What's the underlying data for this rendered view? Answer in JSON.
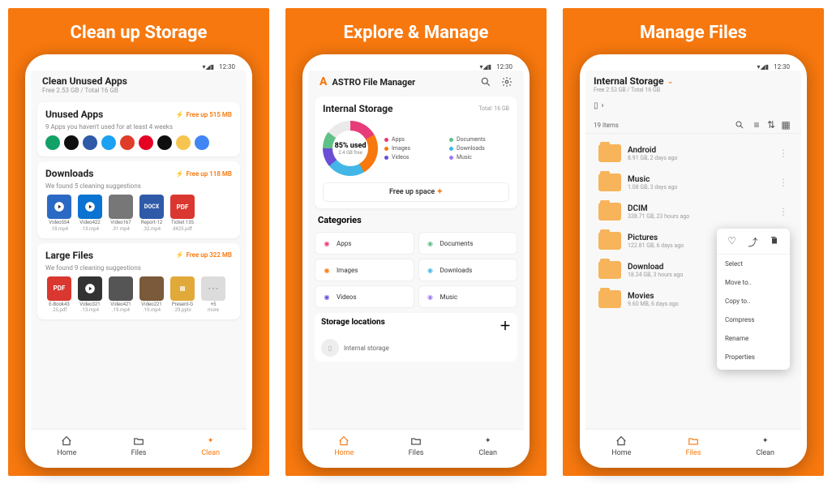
{
  "panels": {
    "p1_title": "Clean up Storage",
    "p2_title": "Explore & Manage",
    "p3_title": "Manage Files"
  },
  "status_bar": {
    "time": "12:30"
  },
  "nav": {
    "home": "Home",
    "files": "Files",
    "clean": "Clean"
  },
  "screen1": {
    "header_title": "Clean Unused Apps",
    "header_sub": "Free 2.53 GB / Total 16 GB",
    "unused": {
      "title": "Unused Apps",
      "freeup": "Free up 515 MB",
      "sub": "9 Apps you haven't used for at least 4 weeks",
      "apps": [
        {
          "bg": "#12a166"
        },
        {
          "bg": "#0f0f0f"
        },
        {
          "bg": "#2e5aa8"
        },
        {
          "bg": "#1da1f2"
        },
        {
          "bg": "#e03c2a"
        },
        {
          "bg": "#e60023"
        },
        {
          "bg": "#0f0f0f"
        },
        {
          "bg": "#f6c550"
        },
        {
          "bg": "#4285f4"
        }
      ]
    },
    "downloads": {
      "title": "Downloads",
      "freeup": "Free up 118 MB",
      "sub": "We found 5 cleaning suggestions",
      "items": [
        {
          "name": "Video554",
          "ext": ".18.mp4",
          "bg": "#2b6ac4",
          "icon": "play"
        },
        {
          "name": "Video422",
          "ext": ".13.mp4",
          "bg": "#0b73d1",
          "icon": "play"
        },
        {
          "name": "Video167",
          "ext": ".31 mp4",
          "bg": "#777",
          "icon": "photo"
        },
        {
          "name": "Report-12",
          "ext": ".32.mp4",
          "bg": "#2e5aa8",
          "icon": "docx"
        },
        {
          "name": "Ticket 135",
          "ext": "d425.pdf",
          "bg": "#d9372f",
          "icon": "pdf"
        }
      ]
    },
    "large": {
      "title": "Large Files",
      "freeup": "Free up 322 MB",
      "sub": "We found 9 cleaning suggestions",
      "items": [
        {
          "name": "E-Book43",
          "ext": ".25.pdf",
          "bg": "#d9372f",
          "icon": "pdf"
        },
        {
          "name": "Video321",
          "ext": ".13.mp4",
          "bg": "#333",
          "icon": "play"
        },
        {
          "name": "Video421",
          "ext": ".19.mp4",
          "bg": "#555",
          "icon": "photo"
        },
        {
          "name": "Video221",
          "ext": ".19.mp4",
          "bg": "#7a5a3a",
          "icon": "photo"
        },
        {
          "name": "Present-G",
          "ext": ".29.pptx",
          "bg": "#e0a93a",
          "icon": "pptx"
        },
        {
          "name": "+5",
          "ext": "more",
          "bg": "#dcdcdc",
          "icon": "more"
        }
      ]
    }
  },
  "screen2": {
    "title": "ASTRO File Manager",
    "storage_title": "Internal Storage",
    "total_label": "Total: 16 GB",
    "used_pct": "85% used",
    "free_label": "2.4 GB free",
    "legend": [
      {
        "c": "#e83c7a",
        "l": "Apps"
      },
      {
        "c": "#5FC088",
        "l": "Documents"
      },
      {
        "c": "#f7780e",
        "l": "Images"
      },
      {
        "c": "#42b6e6",
        "l": "Downloads"
      },
      {
        "c": "#6b4ed6",
        "l": "Videos"
      },
      {
        "c": "#9b7bef",
        "l": "Music"
      }
    ],
    "free_button": "Free up space",
    "categories_title": "Categories",
    "categories": [
      {
        "l": "Apps",
        "c": "#e83c7a"
      },
      {
        "l": "Documents",
        "c": "#5FC088"
      },
      {
        "l": "Images",
        "c": "#f7780e"
      },
      {
        "l": "Downloads",
        "c": "#42b6e6"
      },
      {
        "l": "Videos",
        "c": "#6b4ed6"
      },
      {
        "l": "Music",
        "c": "#9b7bef"
      }
    ],
    "storage_loc_title": "Storage locations",
    "storage_loc_item": "Internal storage"
  },
  "screen3": {
    "title": "Internal Storage",
    "sub": "Free 2.53 GB / Total 16 GB",
    "count": "19 items",
    "files": [
      {
        "name": "Android",
        "meta": "8.91 GB, 2 days ago"
      },
      {
        "name": "Music",
        "meta": "1.08 GB, 3 days ago"
      },
      {
        "name": "DCIM",
        "meta": "338.71 GB, 23 hours ago"
      },
      {
        "name": "Pictures",
        "meta": "122.81 GB, 6 days ago"
      },
      {
        "name": "Download",
        "meta": "18.24 GB, 3 hours ago"
      },
      {
        "name": "Movies",
        "meta": "9.60 MB, 6 days ago"
      }
    ],
    "menu": {
      "select": "Select",
      "moveto": "Move to..",
      "copyto": "Copy to..",
      "compress": "Compress",
      "rename": "Rename",
      "properties": "Properties"
    }
  }
}
